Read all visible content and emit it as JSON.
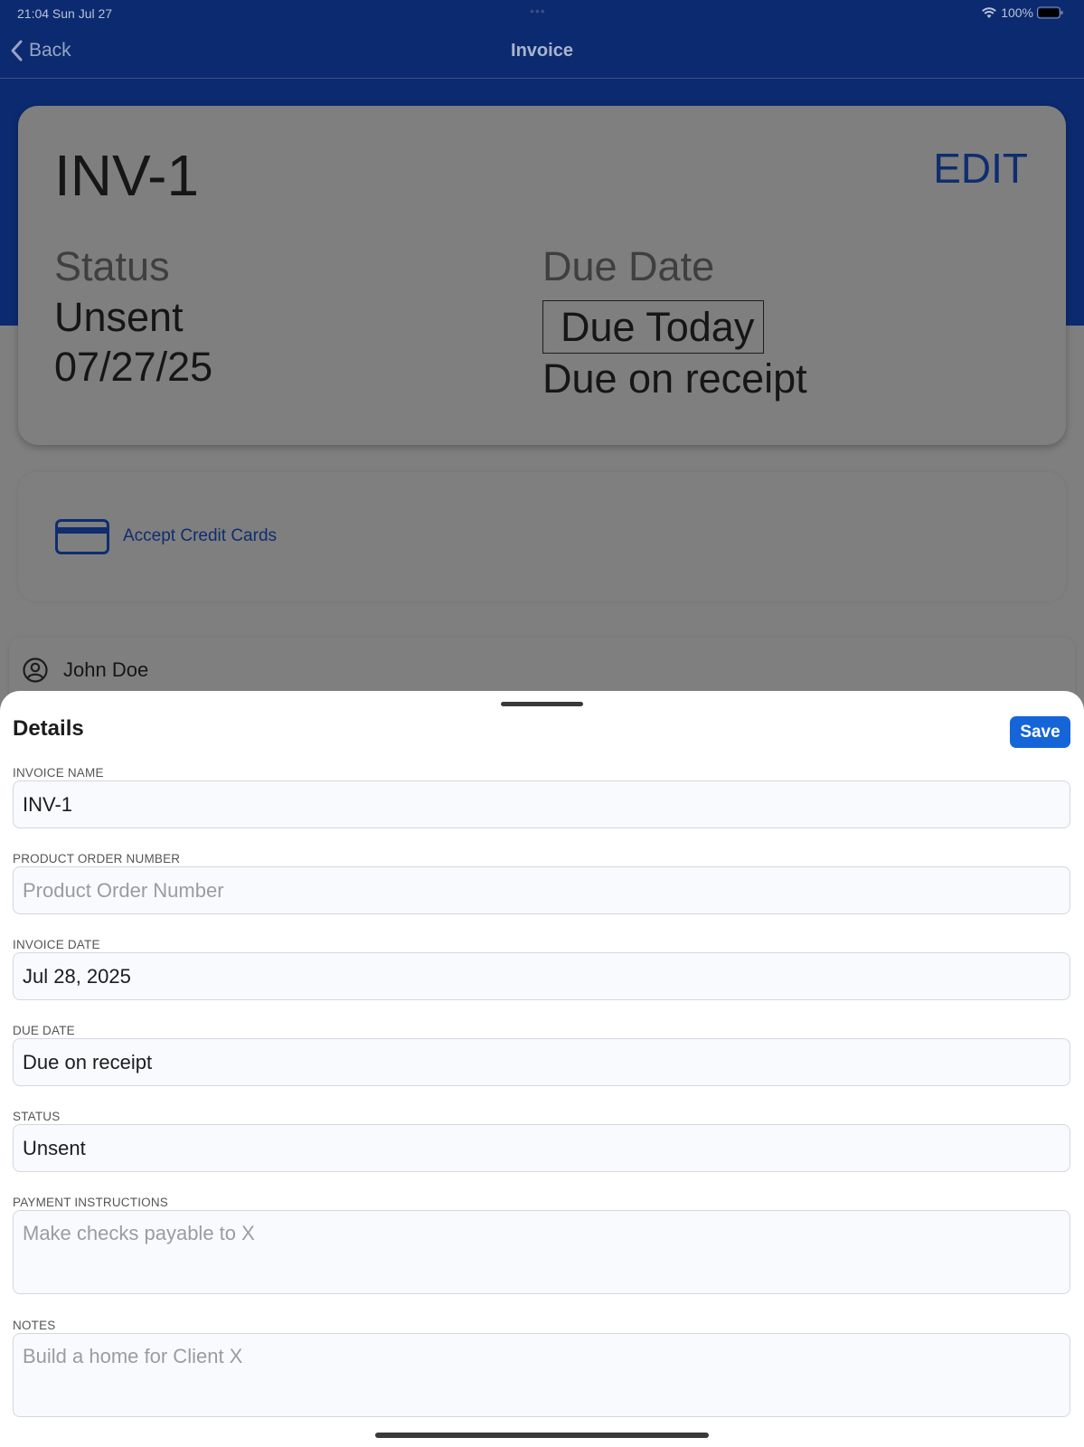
{
  "statusbar": {
    "time_date": "21:04   Sun Jul 27",
    "dots": "•••",
    "battery_pct": "100%",
    "icons": [
      "wifi-icon",
      "battery-icon"
    ]
  },
  "navbar": {
    "back_label": "Back",
    "title": "Invoice",
    "back_icon": "chevron-left-icon"
  },
  "summary": {
    "invoice_id": "INV-1",
    "edit_label": "EDIT",
    "status_label": "Status",
    "status_value": "Unsent",
    "invoice_date": "07/27/25",
    "due_date_label": "Due Date",
    "due_badge": "Due Today",
    "due_terms": "Due on receipt"
  },
  "payments": {
    "icon": "credit-card-icon",
    "label": "Accept Credit Cards"
  },
  "client": {
    "icon": "person-circle-icon",
    "name": "John Doe"
  },
  "sheet": {
    "title": "Details",
    "save_label": "Save",
    "fields": {
      "invoice_name": {
        "label": "INVOICE NAME",
        "value": "INV-1",
        "placeholder": ""
      },
      "po_number": {
        "label": "PRODUCT ORDER NUMBER",
        "value": "",
        "placeholder": "Product Order Number"
      },
      "invoice_date": {
        "label": "INVOICE DATE",
        "value": "Jul 28, 2025",
        "placeholder": ""
      },
      "due_date": {
        "label": "DUE DATE",
        "value": "Due on receipt",
        "placeholder": ""
      },
      "status": {
        "label": "STATUS",
        "value": "Unsent",
        "placeholder": ""
      },
      "payment_instructions": {
        "label": "PAYMENT INSTRUCTIONS",
        "value": "",
        "placeholder": "Make checks payable to X"
      },
      "notes": {
        "label": "NOTES",
        "value": "",
        "placeholder": "Build a home for Client X"
      }
    }
  },
  "colors": {
    "brand_blue": "#1565d8",
    "nav_dark_blue": "#0c2a70",
    "dim_overlay_grey": "#7f7f7f"
  }
}
